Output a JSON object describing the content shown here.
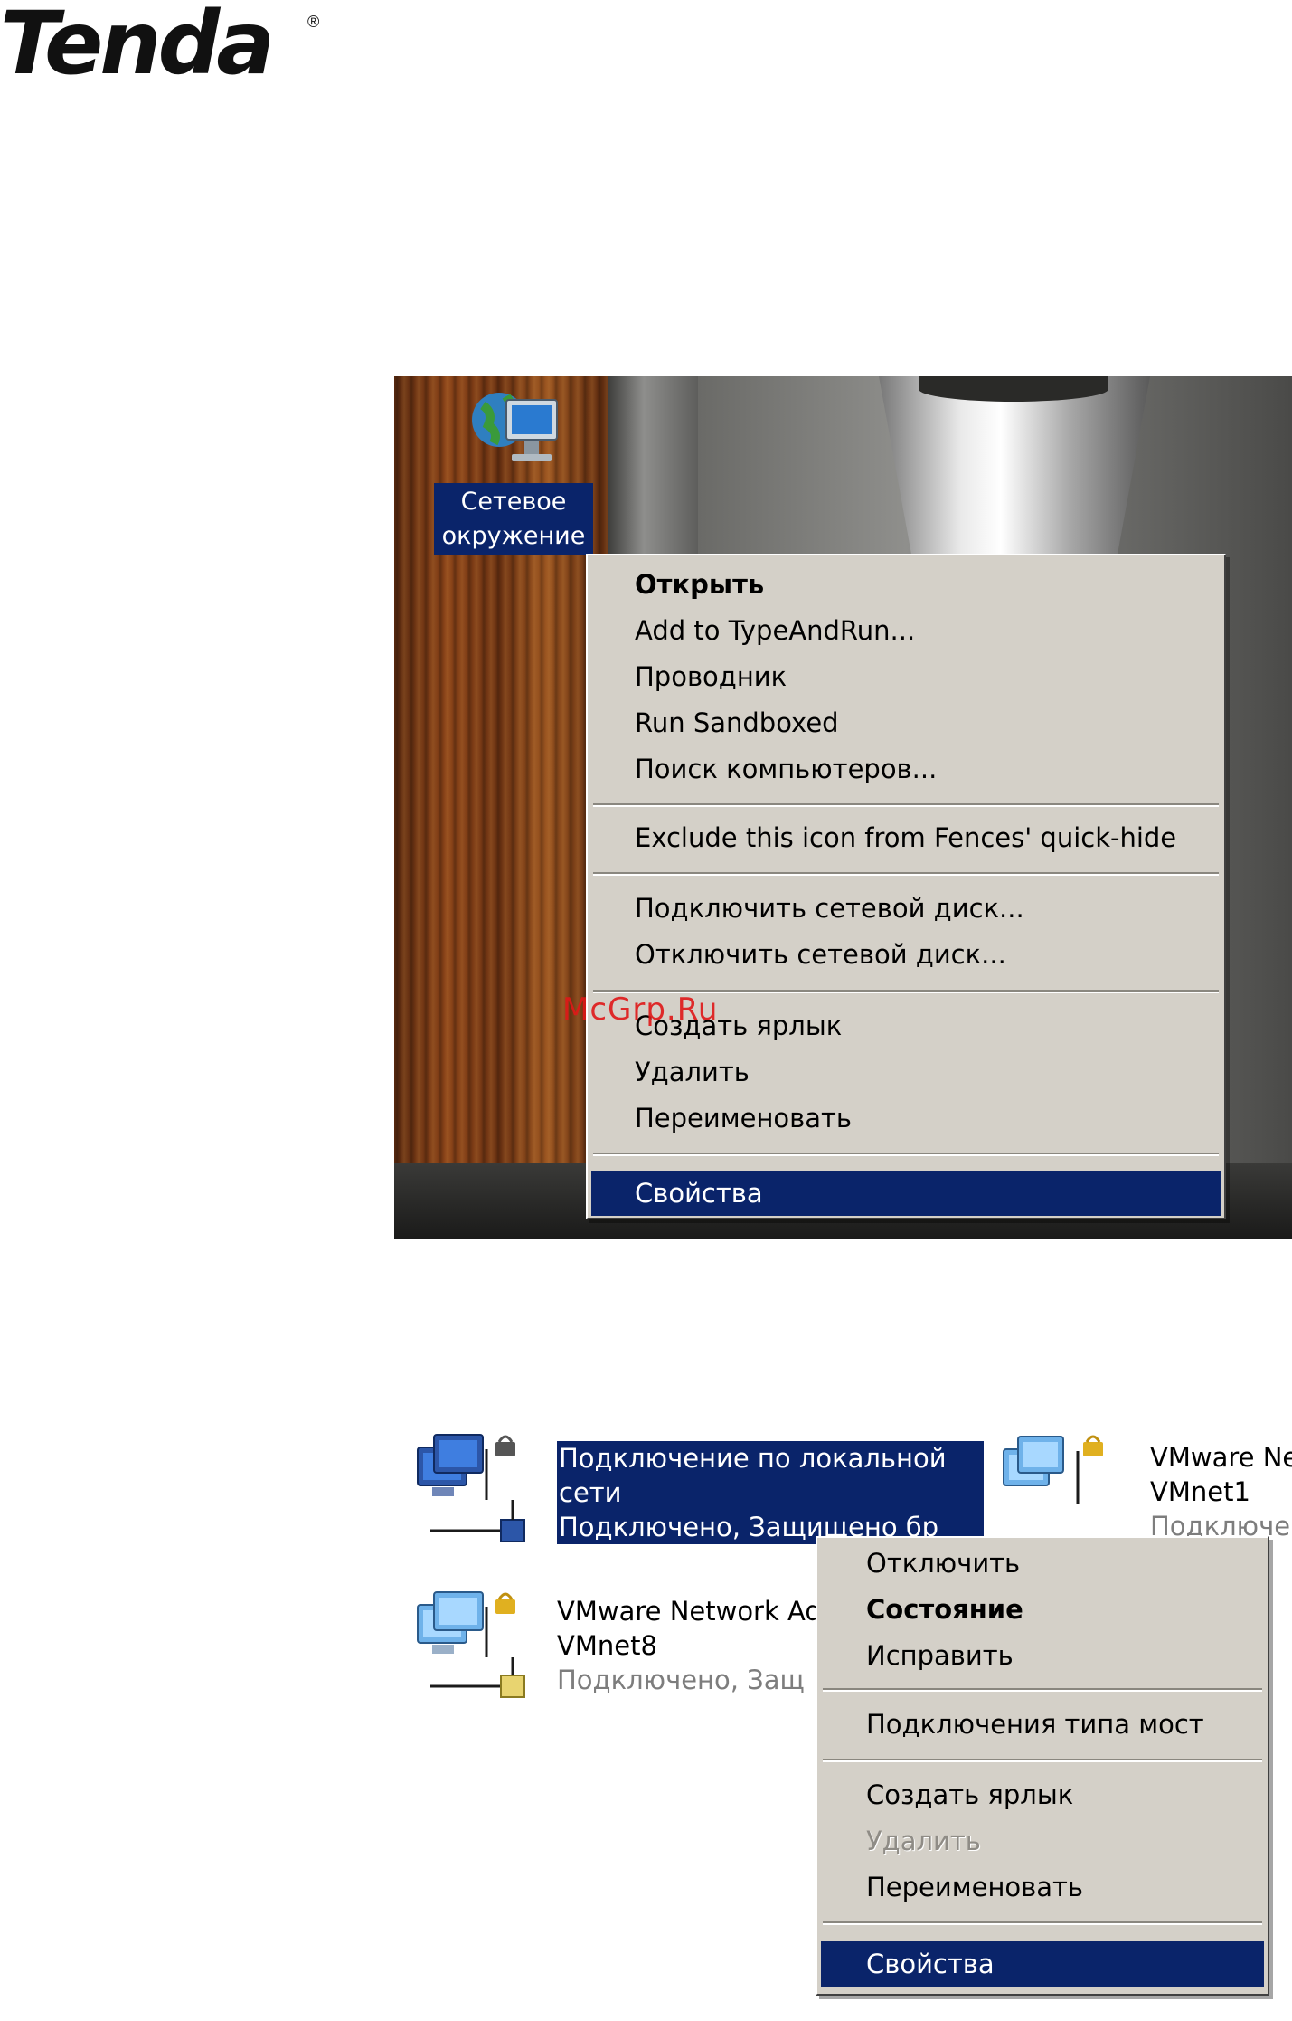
{
  "logo": {
    "text": "Tenda",
    "reg": "®"
  },
  "desktop": {
    "icon_label_line1": "Сетевое",
    "icon_label_line2": "окружение"
  },
  "menu1": {
    "items": [
      {
        "label": "Открыть",
        "bold": true
      },
      {
        "label": "Add to TypeAndRun..."
      },
      {
        "label": "Проводник"
      },
      {
        "label": "Run Sandboxed"
      },
      {
        "label": "Поиск компьютеров..."
      },
      {
        "label": "Exclude this icon from Fences' quick-hide"
      },
      {
        "label": "Подключить сетевой диск..."
      },
      {
        "label": "Отключить сетевой диск..."
      },
      {
        "label": "Создать ярлык"
      },
      {
        "label": "Удалить"
      },
      {
        "label": "Переименовать"
      },
      {
        "label": "Свойства",
        "selected": true
      }
    ]
  },
  "watermark": "McGrp.Ru",
  "connections": {
    "local": {
      "line1": "Подключение по локальной",
      "line2": "сети",
      "line3": "Подключено, Защищено бр"
    },
    "vmnet1": {
      "line1": "VMware Ne",
      "line2": "VMnet1",
      "line3": "Подключе"
    },
    "vmnet8": {
      "line1": "VMware Network Ad",
      "line2": "VMnet8",
      "line3": "Подключено, Защ"
    }
  },
  "menu2": {
    "items": [
      {
        "label": "Отключить"
      },
      {
        "label": "Состояние",
        "bold": true
      },
      {
        "label": "Исправить"
      },
      {
        "label": "Подключения типа мост"
      },
      {
        "label": "Создать ярлык"
      },
      {
        "label": "Удалить",
        "disabled": true
      },
      {
        "label": "Переименовать"
      },
      {
        "label": "Свойства",
        "selected": true
      }
    ]
  }
}
